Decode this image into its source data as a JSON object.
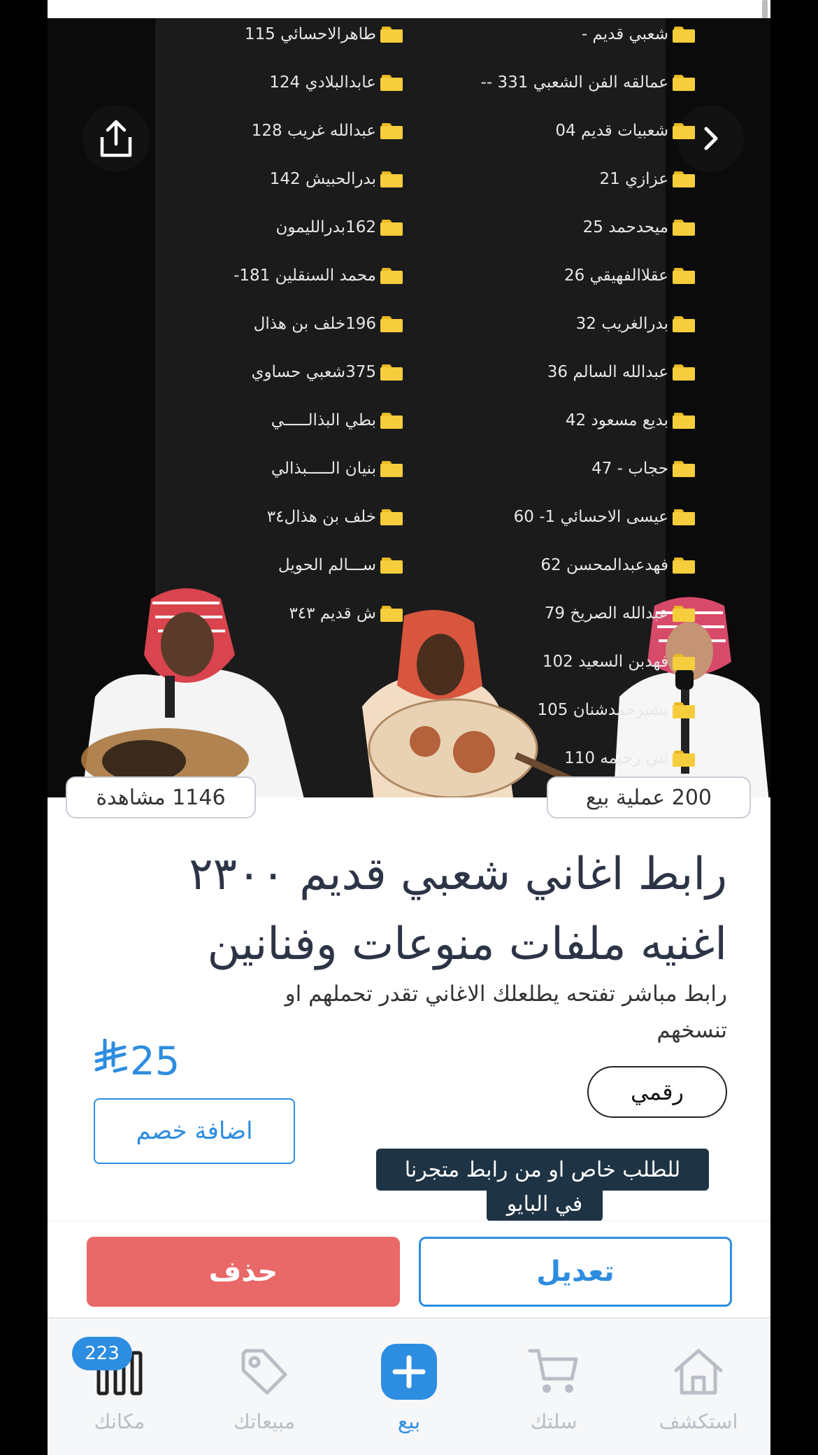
{
  "hero": {
    "folders_right": [
      "شعبي قديم     -",
      "عمالقه الفن الشعبي 331 --",
      "شعبيات قديم 04",
      "عزازي 21",
      "ميحدحمد 25",
      "عقلاالفهيقي 26",
      "بدرالغريب 32",
      "عبدالله السالم 36",
      "بديع مسعود 42",
      "حجاب - 47",
      "عيسى الاحسائي 1- 60",
      "فهدعبدالمحسن 62",
      "عبدالله الصريخ 79",
      "فهدبن السعيد 102",
      "بشيرحمدشنان 105",
      "ثني رحيمه 110"
    ],
    "folders_left": [
      "طاهرالاحسائي 115",
      "عابدالبلادي 124",
      "عبدالله غريب 128",
      "بدرالحبيش 142",
      "162بدرالليمون",
      "محمد السنقلين 181-",
      "196خلف بن هذال",
      "375شعبي حساوي",
      "بطي البذالـــــي",
      "بنيان الـــــبذالي",
      "خلف بن هذال٣٤",
      "ســـالم الحويل",
      "ش قديم ٣٤٣"
    ]
  },
  "stats": {
    "views": "1146 مشاهدة",
    "sales": "200 عملية بيع"
  },
  "product": {
    "title": "رابط اغاني شعبي قديم ٢٣٠٠ اغنيه ملفات منوعات وفنانين",
    "description": "رابط مباشر تفتحه يطلعلك الاغاني تقدر تحملهم او تنسخهم",
    "price": "25",
    "currency_symbol": "⃁",
    "type": "رقمي",
    "discount_label": "اضافة خصم"
  },
  "overlay_caption": {
    "line1": "للطلب خاص او من رابط متجرنا",
    "line2": "في البايو"
  },
  "actions": {
    "edit": "تعديل",
    "delete": "حذف"
  },
  "tabbar": {
    "explore": "استكشف",
    "cart": "سلتك",
    "sell": "بيع",
    "sales": "مبيعاتك",
    "store": "مكانك",
    "store_badge": "223"
  },
  "colors": {
    "accent": "#2d8de0",
    "danger": "#e96868",
    "title": "#2c3446"
  }
}
